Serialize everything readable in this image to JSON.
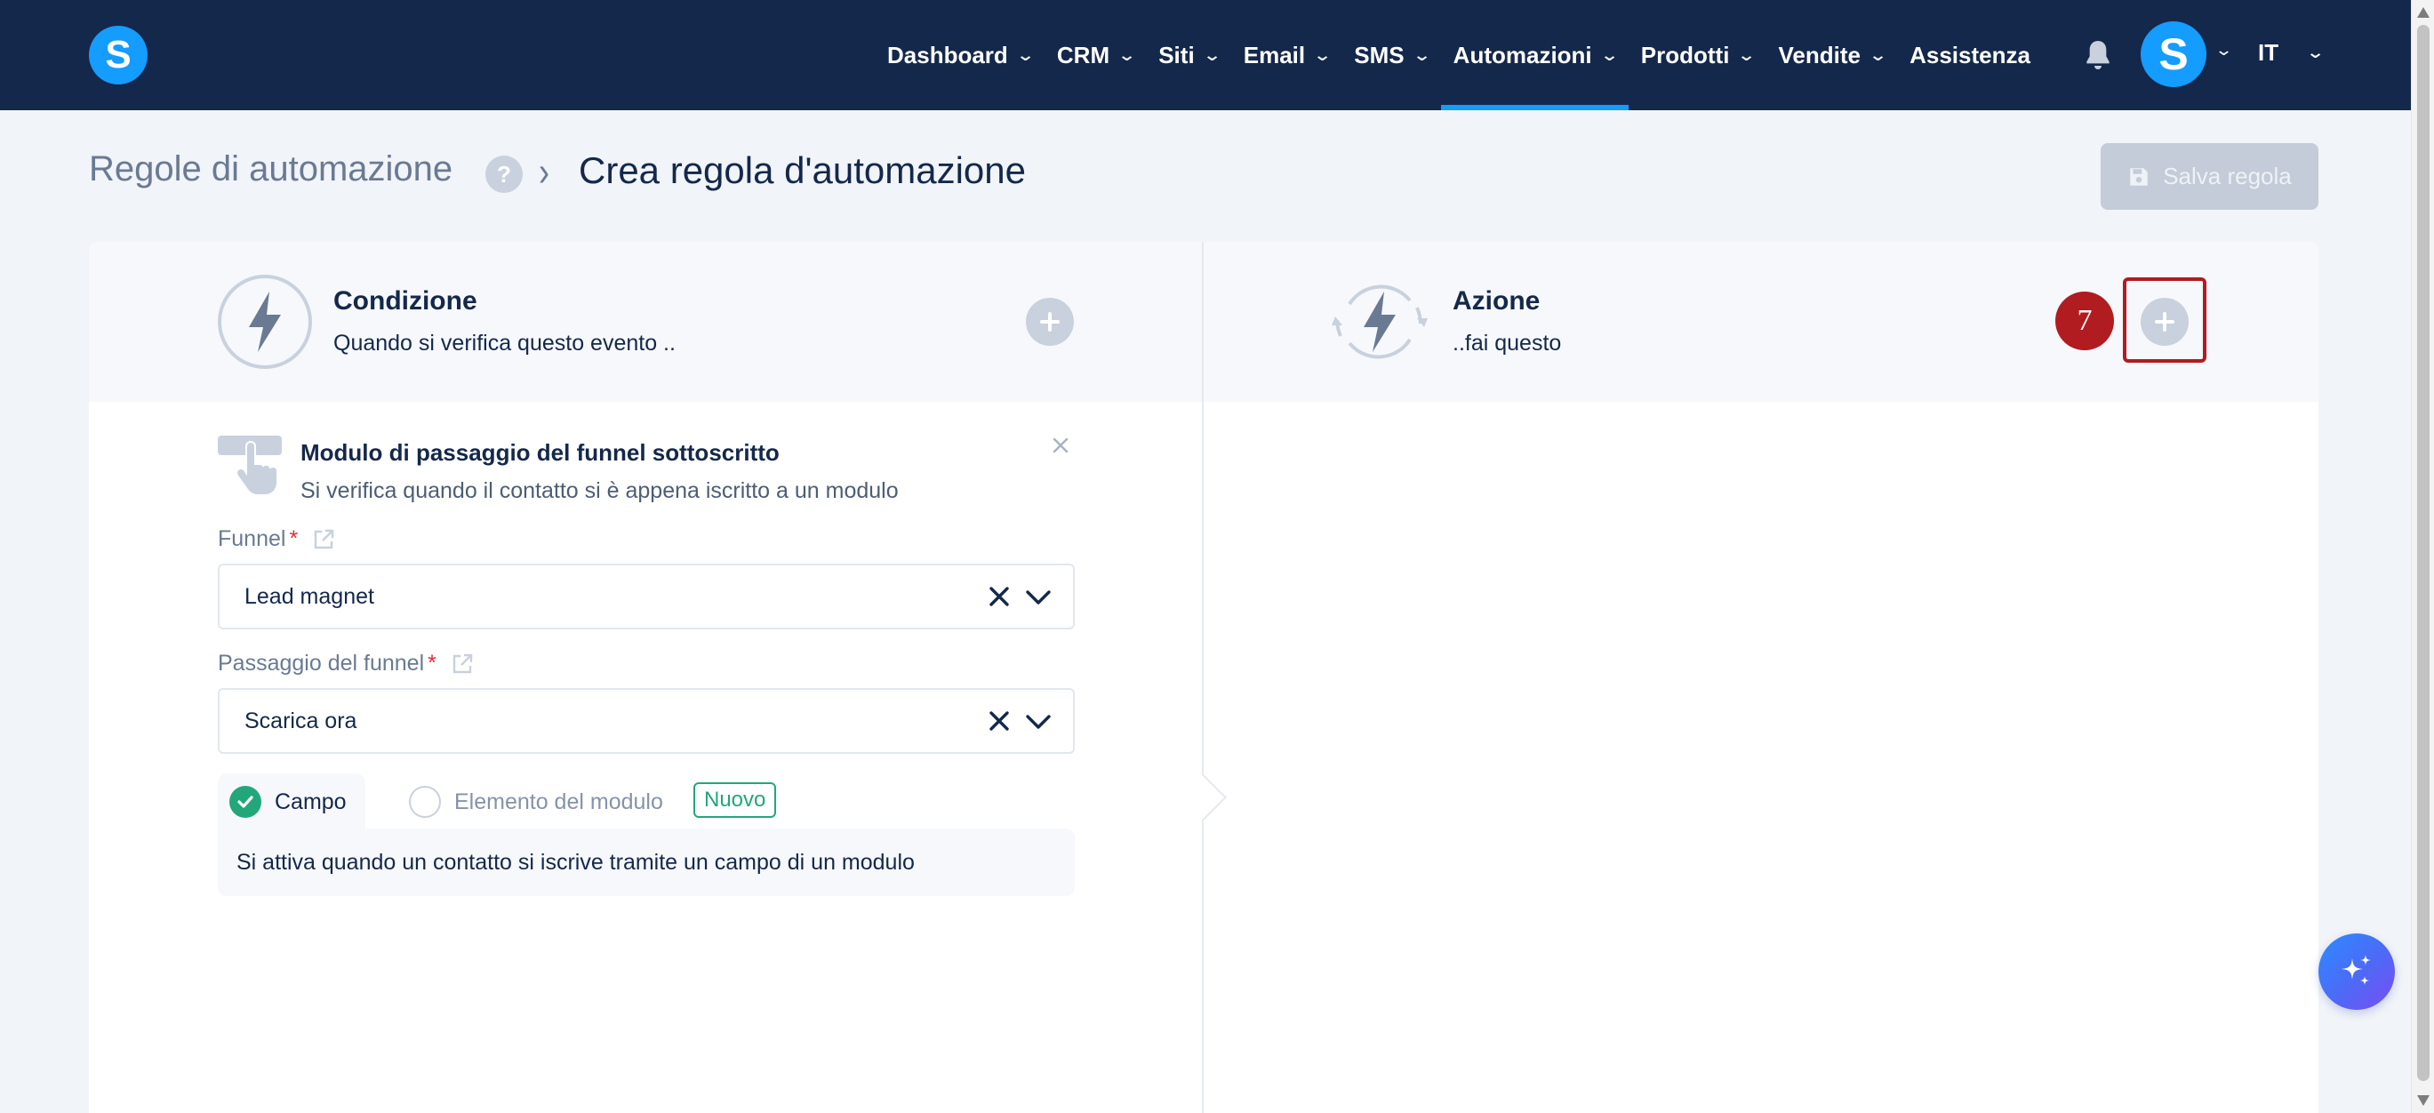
{
  "brand": {
    "logo_letter": "S",
    "accent": "#149cff",
    "nav_bg": "#14284b"
  },
  "nav": {
    "items": [
      {
        "label": "Dashboard",
        "has_dropdown": true
      },
      {
        "label": "CRM",
        "has_dropdown": true
      },
      {
        "label": "Siti",
        "has_dropdown": true
      },
      {
        "label": "Email",
        "has_dropdown": true
      },
      {
        "label": "SMS",
        "has_dropdown": true
      },
      {
        "label": "Automazioni",
        "has_dropdown": true,
        "active": true
      },
      {
        "label": "Prodotti",
        "has_dropdown": true
      },
      {
        "label": "Vendite",
        "has_dropdown": true
      },
      {
        "label": "Assistenza",
        "has_dropdown": false
      }
    ],
    "notifications_icon": "bell-icon",
    "avatar_letter": "S",
    "language": "IT"
  },
  "breadcrumb": {
    "root": "Regole di automazione",
    "help": "?",
    "current": "Crea regola d'automazione"
  },
  "toolbar": {
    "save_label": "Salva regola",
    "save_icon": "floppy-disk-icon"
  },
  "condition": {
    "title": "Condizione",
    "subtitle": "Quando si verifica questo evento ..",
    "trigger": {
      "title": "Modulo di passaggio del funnel sottoscritto",
      "description": "Si verifica quando il contatto si è appena iscritto a un modulo"
    },
    "funnel": {
      "label": "Funnel",
      "required_mark": "*",
      "value": "Lead magnet"
    },
    "funnel_step": {
      "label": "Passaggio del funnel",
      "required_mark": "*",
      "value": "Scarica ora"
    },
    "options": [
      {
        "label": "Campo",
        "checked": true
      },
      {
        "label": "Elemento del modulo",
        "checked": false,
        "badge": "Nuovo"
      }
    ],
    "option_description": "Si attiva quando un contatto si iscrive tramite un campo di un modulo"
  },
  "action": {
    "title": "Azione",
    "subtitle": "..fai questo",
    "step_number": "7"
  }
}
